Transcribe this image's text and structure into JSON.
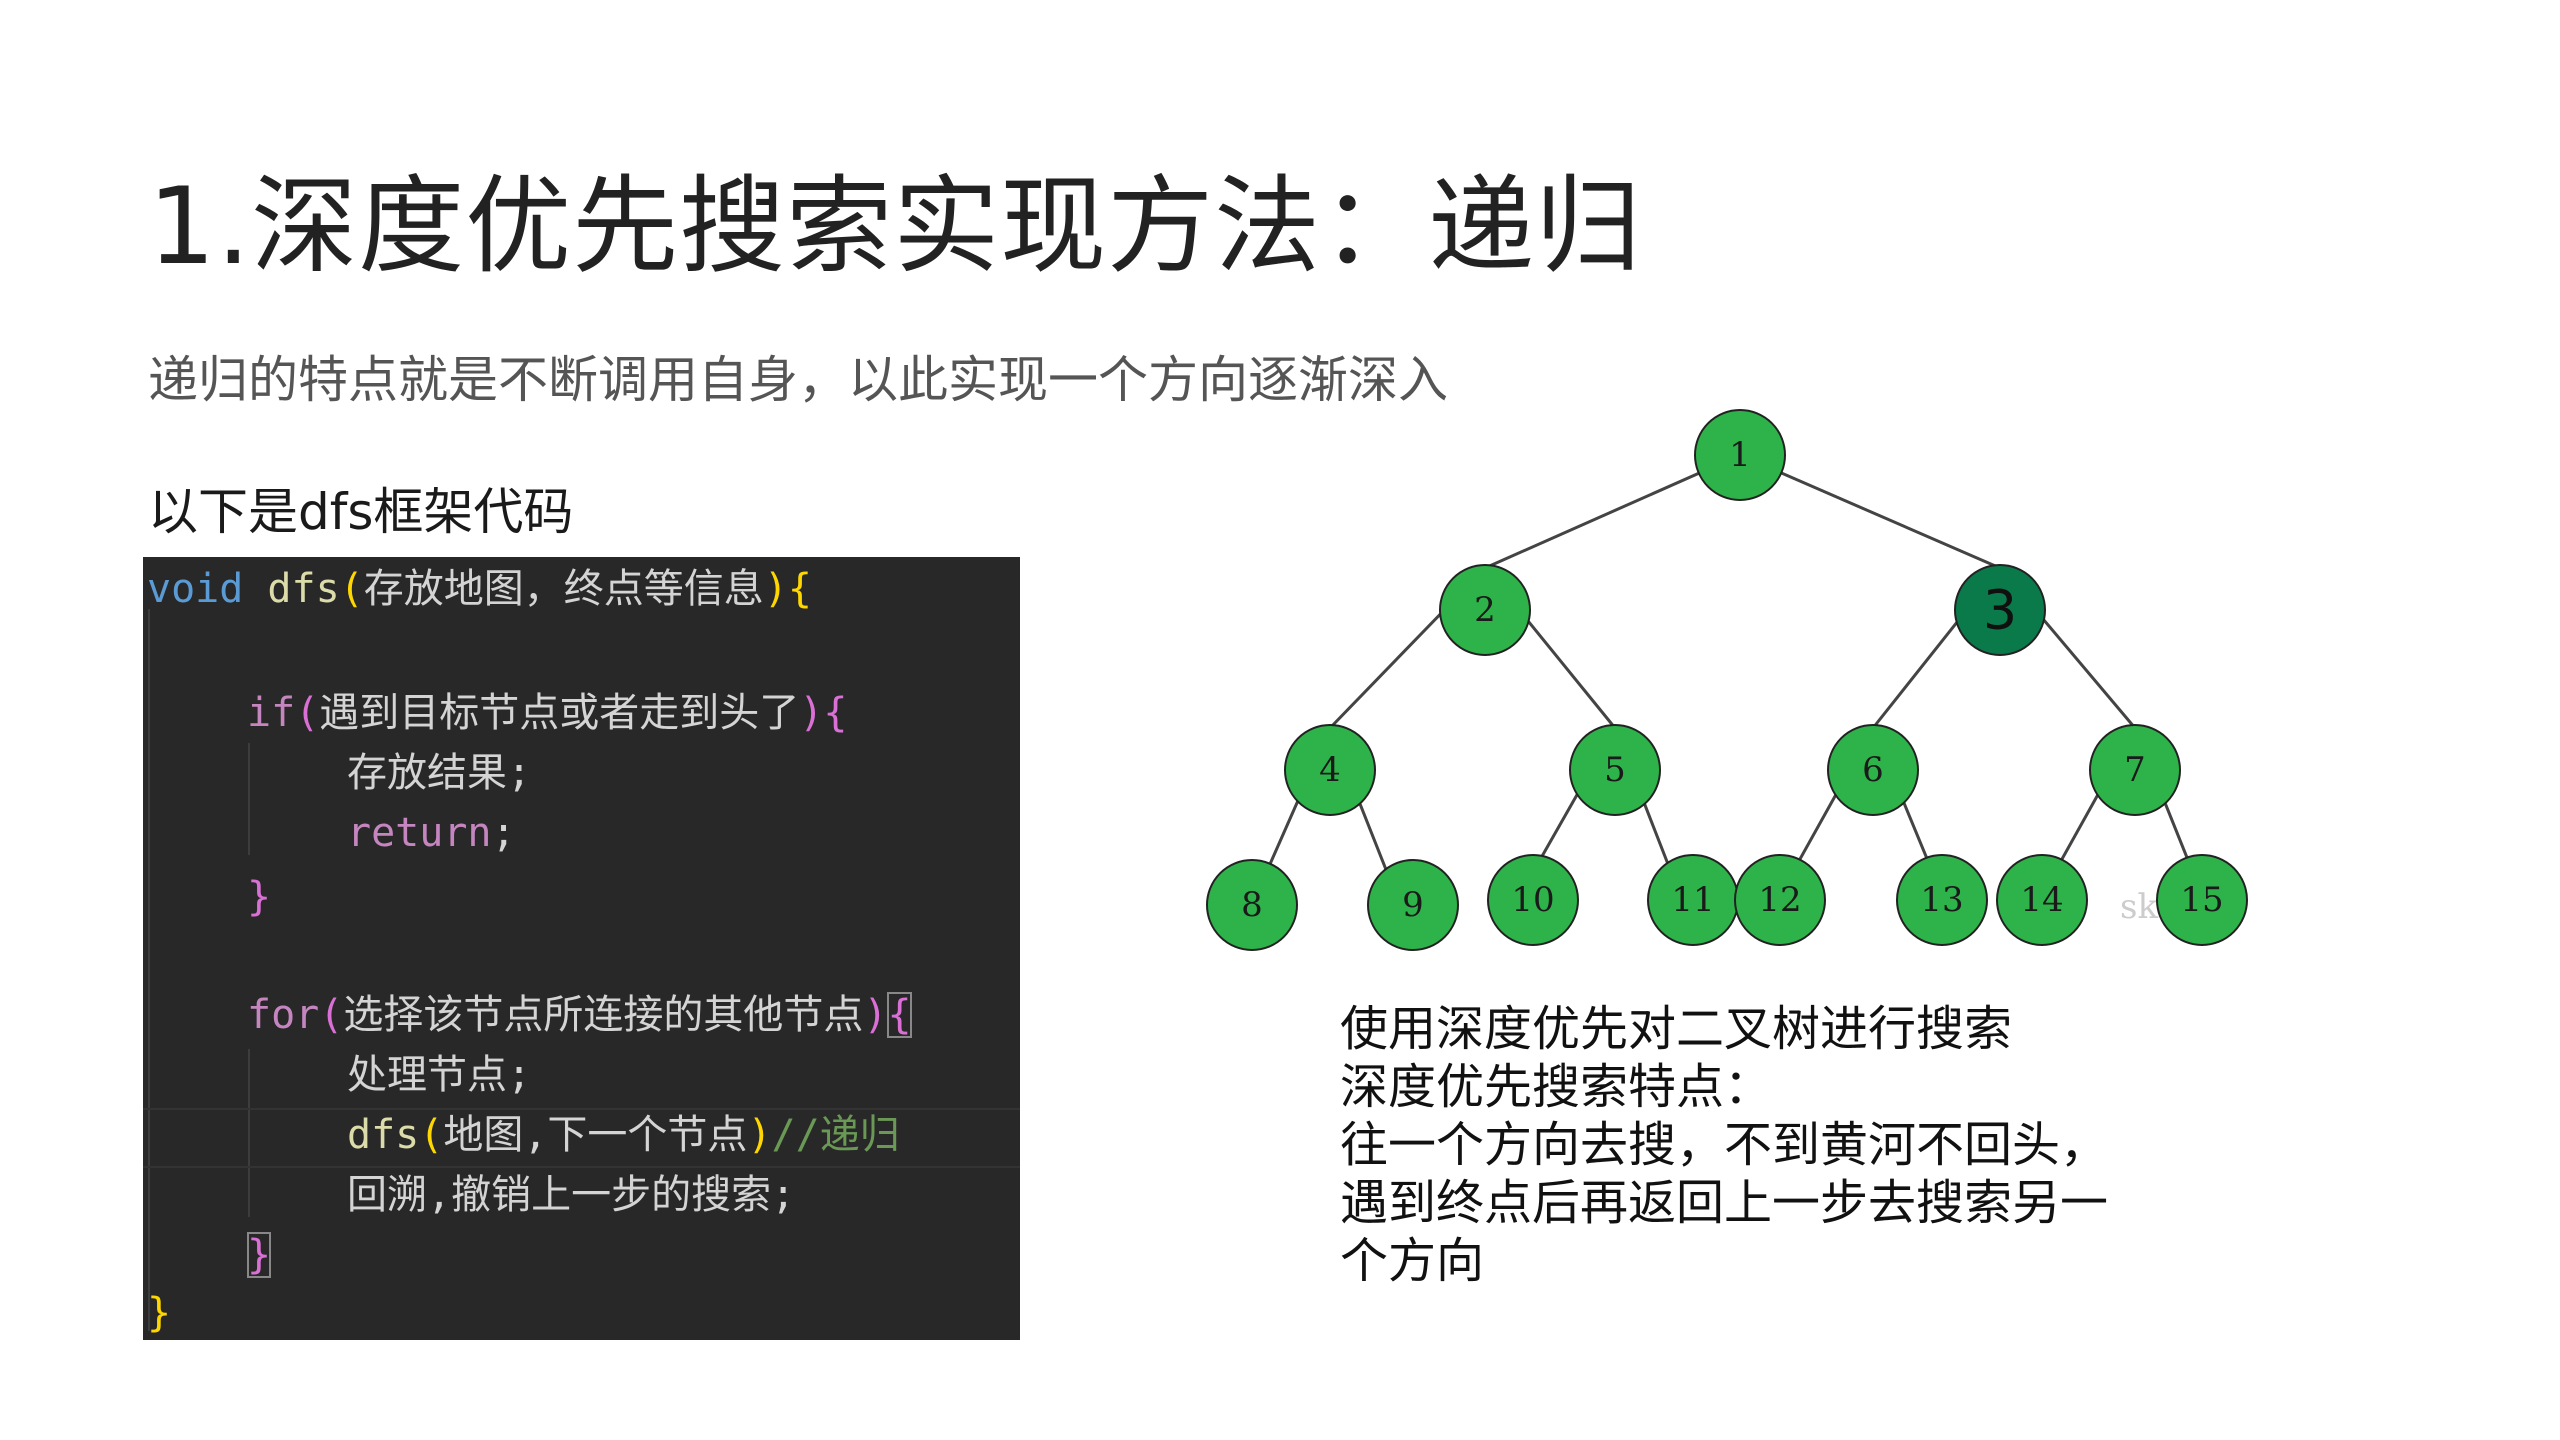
{
  "slide": {
    "title": "1.深度优先搜索实现方法：递归",
    "subtitle": "递归的特点就是不断调用自身，以此实现一个方向逐渐深入",
    "intro": "以下是dfs框架代码",
    "description_lines": [
      "使用深度优先对二叉树进行搜索",
      "深度优先搜索特点：",
      "往一个方向去搜，不到黄河不回头，",
      "遇到终点后再返回上一步去搜索另一",
      "个方向"
    ]
  },
  "code": {
    "line1": {
      "kw": "void",
      "fn": "dfs",
      "open": "(",
      "text": "存放地图，终点等信息",
      "close": ")",
      "brace": "{"
    },
    "line2": {
      "kw": "if",
      "open": "(",
      "text": "遇到目标节点或者走到头了",
      "close": ")",
      "brace": "{"
    },
    "line3": {
      "text": "存放结果;"
    },
    "line4": {
      "kw": "return",
      "semi": ";"
    },
    "line5": {
      "brace": "}"
    },
    "line6": {
      "kw": "for",
      "open": "(",
      "text": "选择该节点所连接的其他节点",
      "close": ")",
      "brace": "{"
    },
    "line7": {
      "text": "处理节点;"
    },
    "line8": {
      "fn": "dfs",
      "open": "(",
      "text": "地图,下一个节点",
      "close": ")",
      "comment": "//递归"
    },
    "line9": {
      "text": "回溯,撤销上一步的搜索;"
    },
    "line10": {
      "brace": "}"
    },
    "line11": {
      "brace": "}"
    }
  },
  "tree": {
    "node_color": "#2eb34a",
    "highlight_color": "#0b7a4a",
    "nodes": [
      "1",
      "2",
      "3",
      "4",
      "5",
      "6",
      "7",
      "8",
      "9",
      "10",
      "11",
      "12",
      "13",
      "14",
      "15"
    ],
    "watermark": "sk"
  }
}
